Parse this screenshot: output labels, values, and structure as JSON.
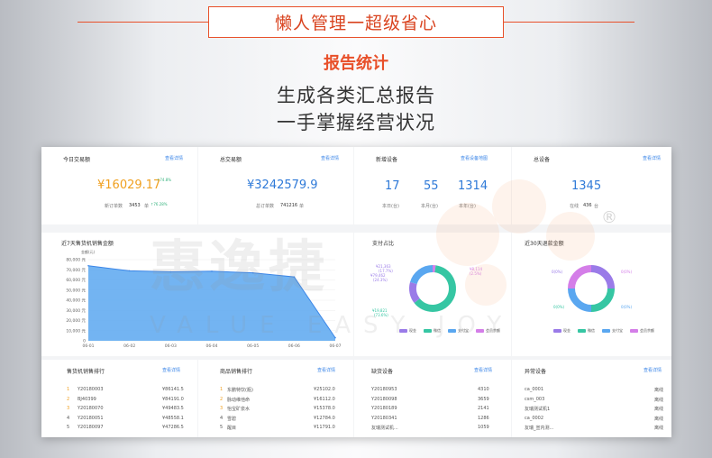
{
  "header": {
    "banner": "懒人管理一超级省心",
    "sub_title": "报告统计",
    "slogan_line1": "生成各类汇总报告",
    "slogan_line2": "一手掌握经营状况"
  },
  "colors": {
    "accent": "#e8502a",
    "link": "#3b86e8",
    "orange_value": "#f0a020",
    "blue_value": "#2f7ad8"
  },
  "watermark": {
    "text": "惠逸捷",
    "sub": "VALUE EASY JOY",
    "reg": "®"
  },
  "stats": {
    "today": {
      "title": "今日交易额",
      "link": "查看详情",
      "value": "¥16029.17",
      "growth": "↑74.8%",
      "order_label": "新订单数",
      "order_count": "3453",
      "order_unit": "单",
      "order_growth": "↑76.28%"
    },
    "total": {
      "title": "总交易额",
      "link": "查看详情",
      "value": "¥3242579.9",
      "order_label": "总订单数",
      "order_count": "741216",
      "order_unit": "单"
    },
    "new_devices": {
      "title": "新增设备",
      "link": "查看设备地图",
      "values": [
        "17",
        "55",
        "1314"
      ],
      "labels": [
        "本日(台)",
        "本月(台)",
        "本年(台)"
      ]
    },
    "all_devices": {
      "title": "总设备",
      "link": "查看详情",
      "value": "1345",
      "online_label": "在线",
      "online_count": "436",
      "online_unit": "台"
    }
  },
  "charts": {
    "sales": {
      "title": "近7天售货机销售金额",
      "unit_label": "金额(元)"
    },
    "payment": {
      "title": "支付占比",
      "labels": [
        "¥21,363",
        "(17.7%)",
        "¥79,462",
        "(24.3%)",
        "¥19,821",
        "(73.6%)",
        "¥8,114",
        "(2.5%)"
      ]
    },
    "refund": {
      "title": "近30天退款金额",
      "labels": [
        "0(0%)",
        "0(0%)",
        "0(0%)",
        "0(0%)"
      ]
    }
  },
  "legend": [
    "现金",
    "微信",
    "支付宝",
    "会员余额"
  ],
  "chart_data": [
    {
      "type": "area",
      "title": "近7天售货机销售金额",
      "ylabel": "金额(元)",
      "x": [
        "06-01",
        "06-02",
        "06-03",
        "06-04",
        "06-05",
        "06-06",
        "06-07"
      ],
      "y_ticks": [
        "80,000 元",
        "70,000 元",
        "60,000 元",
        "50,000 元",
        "40,000 元",
        "30,000 元",
        "20,000 元",
        "10,000 元",
        "0"
      ],
      "values": [
        74000,
        69000,
        68000,
        68500,
        67000,
        63000,
        3000
      ],
      "ylim": [
        0,
        80000
      ],
      "grid": true
    },
    {
      "type": "pie",
      "title": "支付占比",
      "categories": [
        "现金",
        "微信",
        "支付宝",
        "会员余额"
      ],
      "values": [
        2.5,
        73.6,
        17.7,
        24.3
      ]
    },
    {
      "type": "pie",
      "title": "近30天退款金额",
      "categories": [
        "现金",
        "微信",
        "支付宝",
        "会员余额"
      ],
      "values": [
        25,
        25,
        25,
        25
      ]
    }
  ],
  "rank_lists": {
    "device_rank": {
      "title": "售货机销售排行",
      "link": "查看详情",
      "rows": [
        {
          "rank": "1",
          "name": "Y20180003",
          "value": "¥86141.5"
        },
        {
          "rank": "2",
          "name": "BJ40399",
          "value": "¥84191.0"
        },
        {
          "rank": "3",
          "name": "Y20180070",
          "value": "¥49483.5"
        },
        {
          "rank": "4",
          "name": "Y20180051",
          "value": "¥48558.1"
        },
        {
          "rank": "5",
          "name": "Y20180097",
          "value": "¥47286.5"
        }
      ]
    },
    "product_rank": {
      "title": "商品销售排行",
      "link": "查看详情",
      "rows": [
        {
          "rank": "1",
          "name": "东鹏特饮(瓶)",
          "value": "¥25102.0"
        },
        {
          "rank": "2",
          "name": "脉动维他命",
          "value": "¥16112.0"
        },
        {
          "rank": "3",
          "name": "怡宝矿泉水",
          "value": "¥15378.0"
        },
        {
          "rank": "4",
          "name": "雪碧",
          "value": "¥12784.0"
        },
        {
          "rank": "5",
          "name": "醒目",
          "value": "¥11791.0"
        }
      ]
    },
    "low_stock": {
      "title": "缺货设备",
      "link": "查看详情",
      "rows": [
        {
          "name": "Y20180953",
          "value": "4310"
        },
        {
          "name": "Y20180098",
          "value": "3659"
        },
        {
          "name": "Y20180189",
          "value": "2141"
        },
        {
          "name": "Y20180341",
          "value": "1286"
        },
        {
          "name": "友瑞测试机...",
          "value": "1059"
        }
      ]
    },
    "abnormal": {
      "title": "异常设备",
      "link": "查看详情",
      "rows": [
        {
          "name": "ca_0001",
          "value": "离线"
        },
        {
          "name": "csm_003",
          "value": "离线"
        },
        {
          "name": "友瑞测试机1",
          "value": "离线"
        },
        {
          "name": "ca_0002",
          "value": "离线"
        },
        {
          "name": "友瑞_宣内测...",
          "value": "离线"
        }
      ]
    }
  }
}
